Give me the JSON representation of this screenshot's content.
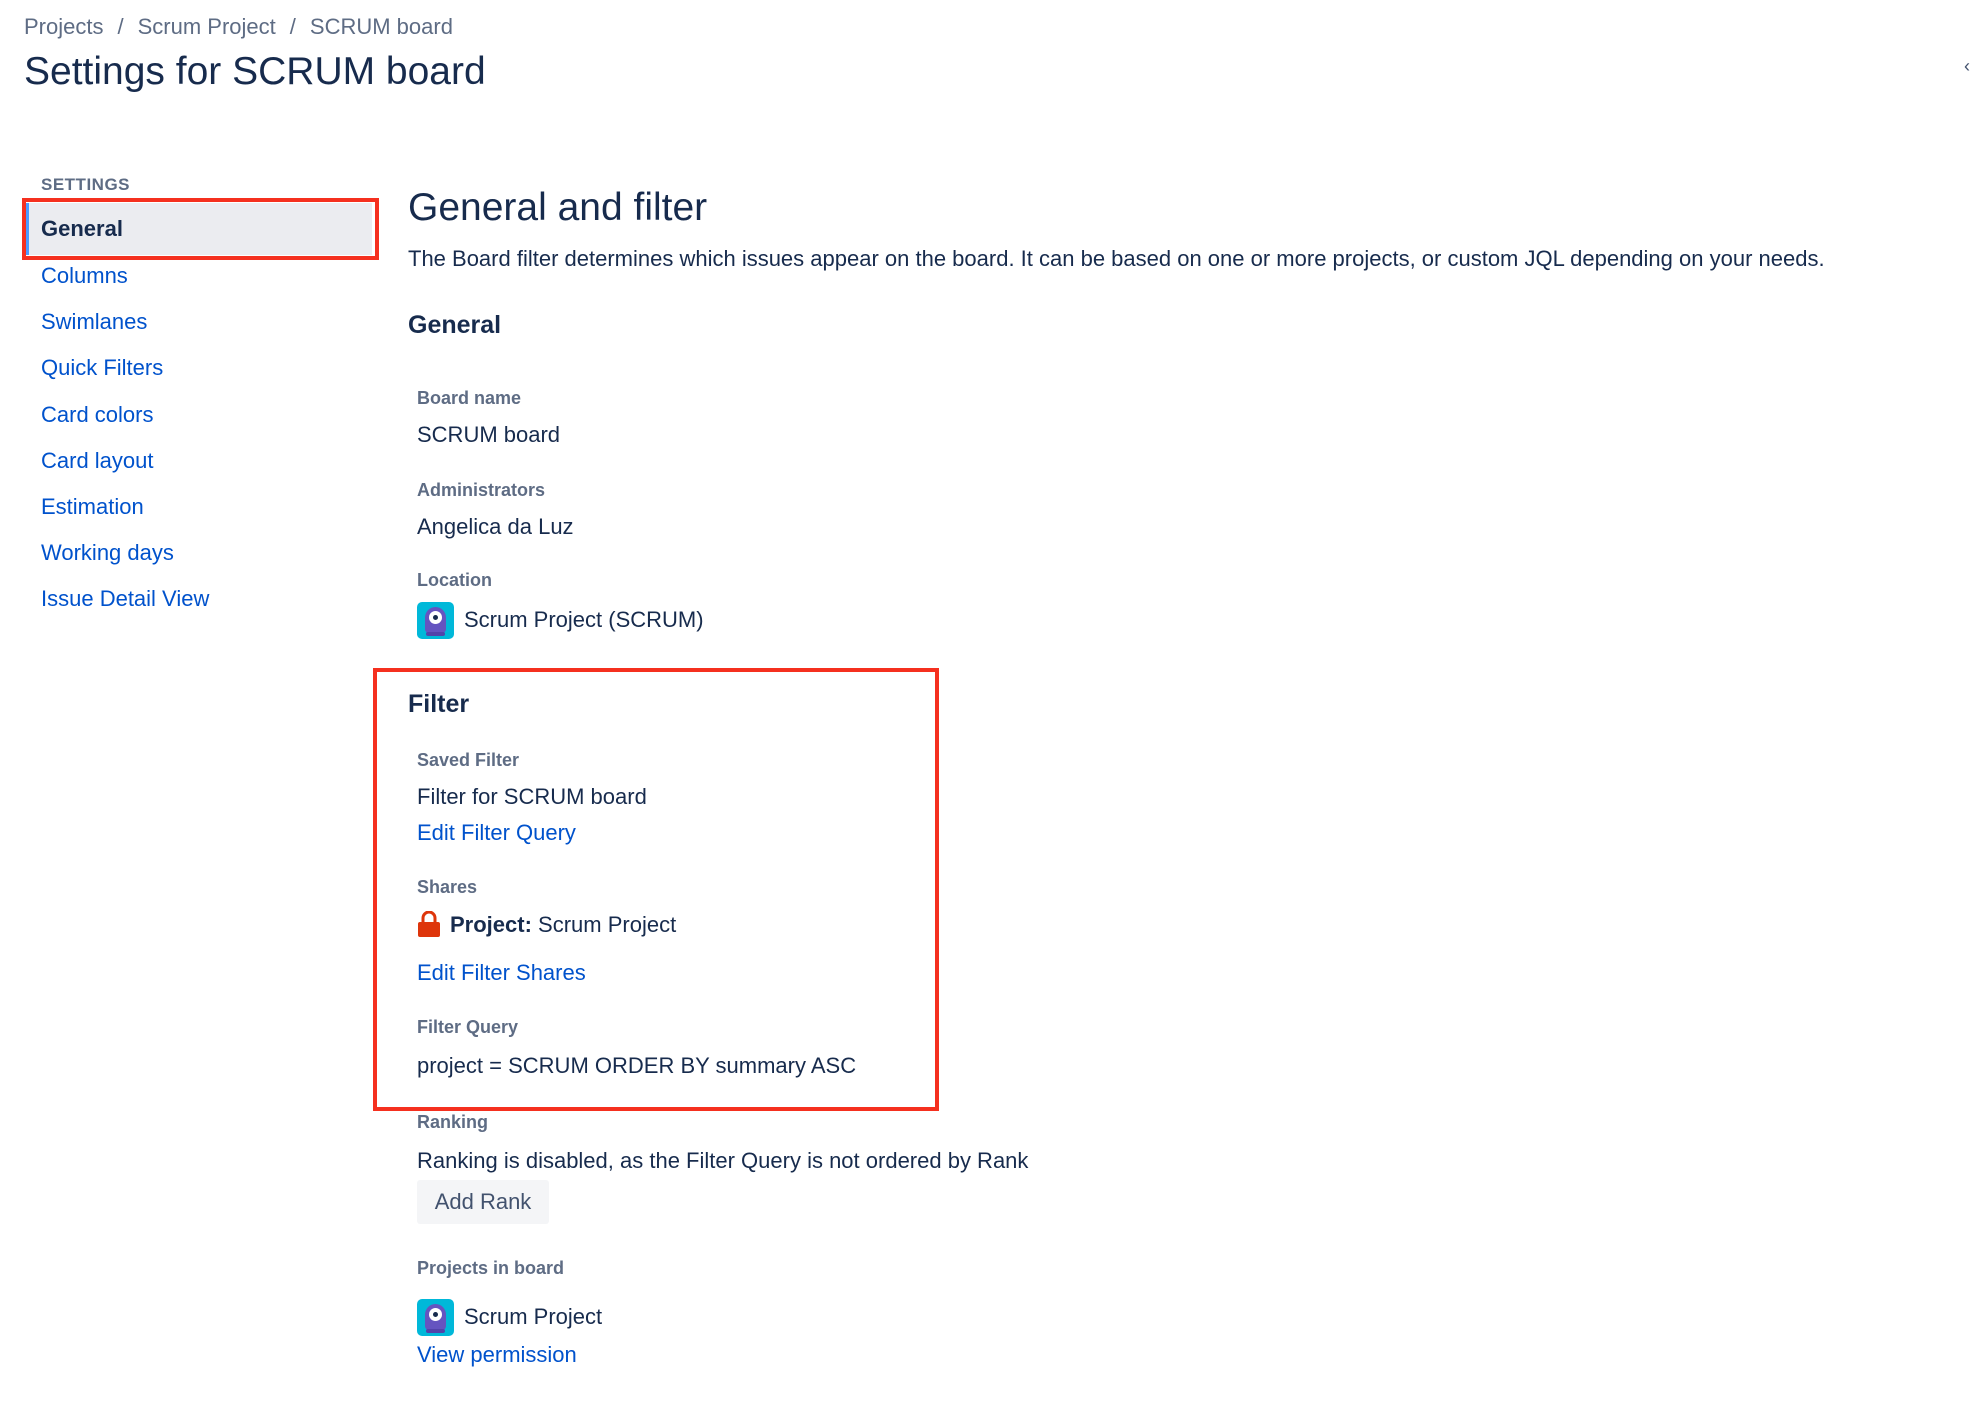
{
  "breadcrumbs": [
    {
      "label": "Projects"
    },
    {
      "label": "Scrum Project"
    },
    {
      "label": "SCRUM board"
    }
  ],
  "breadcrumb_separator": "/",
  "page_title": "Settings for SCRUM board",
  "sidebar": {
    "heading": "SETTINGS",
    "items": [
      {
        "label": "General",
        "active": true
      },
      {
        "label": "Columns"
      },
      {
        "label": "Swimlanes"
      },
      {
        "label": "Quick Filters"
      },
      {
        "label": "Card colors"
      },
      {
        "label": "Card layout"
      },
      {
        "label": "Estimation"
      },
      {
        "label": "Working days"
      },
      {
        "label": "Issue Detail View"
      }
    ]
  },
  "main": {
    "title": "General and filter",
    "description": "The Board filter determines which issues appear on the board. It can be based on one or more projects, or custom JQL depending on your needs.",
    "general": {
      "heading": "General",
      "board_name_label": "Board name",
      "board_name": "SCRUM board",
      "administrators_label": "Administrators",
      "administrators": "Angelica da Luz",
      "location_label": "Location",
      "location": "Scrum Project (SCRUM)"
    },
    "filter": {
      "heading": "Filter",
      "saved_filter_label": "Saved Filter",
      "saved_filter": "Filter for SCRUM board",
      "edit_query_link": "Edit Filter Query",
      "shares_label": "Shares",
      "shares_type": "Project:",
      "shares_value": "Scrum Project",
      "edit_shares_link": "Edit Filter Shares",
      "filter_query_label": "Filter Query",
      "filter_query": "project = SCRUM ORDER BY summary ASC"
    },
    "ranking": {
      "label": "Ranking",
      "text": "Ranking is disabled, as the Filter Query is not ordered by Rank",
      "button": "Add Rank"
    },
    "projects_in_board": {
      "label": "Projects in board",
      "project": "Scrum Project",
      "view_permission_link": "View permission"
    }
  },
  "icons": {
    "project_avatar": "project-avatar-icon",
    "lock": "lock-icon"
  },
  "colors": {
    "link": "#0052cc",
    "text": "#172b4d",
    "muted": "#5e6c84",
    "highlight": "#f5301f",
    "active_border": "#4c9aff",
    "lock": "#de350b"
  }
}
